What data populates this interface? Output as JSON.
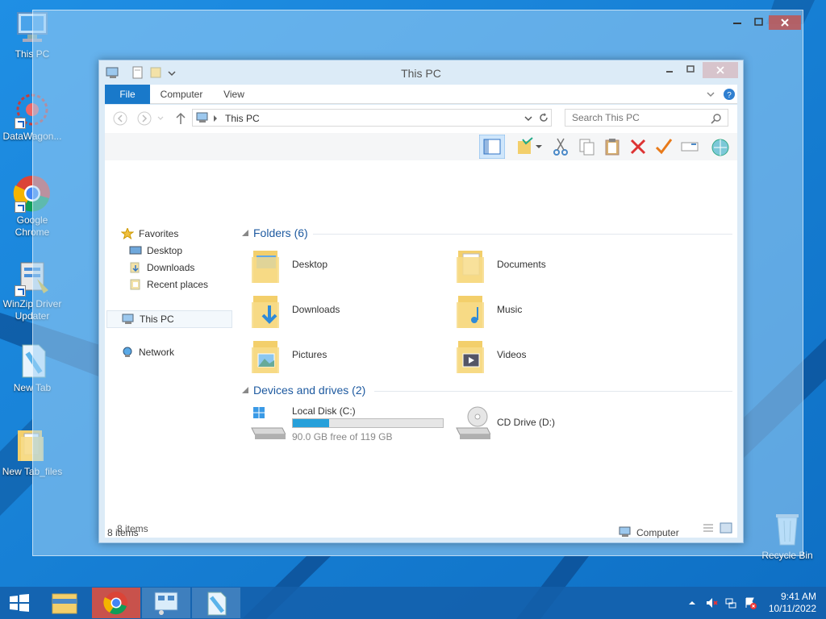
{
  "desktop": {
    "icons": [
      {
        "label": "This PC"
      },
      {
        "label": "DataWagon..."
      },
      {
        "label": "Google Chrome"
      },
      {
        "label": "WinZip Driver Updater"
      },
      {
        "label": "New Tab"
      },
      {
        "label": "New Tab_files"
      },
      {
        "label": "Recycle Bin"
      }
    ]
  },
  "window": {
    "title": "This PC",
    "tabs": [
      "File",
      "Computer",
      "View"
    ],
    "address": "This PC",
    "search_placeholder": "Search This PC"
  },
  "nav": {
    "favorites": "Favorites",
    "favorites_items": [
      "Desktop",
      "Downloads",
      "Recent places"
    ],
    "this_pc": "This PC",
    "network": "Network"
  },
  "main": {
    "folders_header": "Folders (6)",
    "folders": [
      "Desktop",
      "Documents",
      "Downloads",
      "Music",
      "Pictures",
      "Videos"
    ],
    "devices_header": "Devices and drives (2)",
    "drives": [
      {
        "label": "Local Disk (C:)",
        "free": "90.0 GB free of 119 GB",
        "used_fraction": 0.244
      },
      {
        "label": "CD Drive (D:)"
      }
    ]
  },
  "status": {
    "count_inner": "8 items",
    "count_outer": "8 items",
    "computer": "Computer"
  },
  "taskbar": {
    "time": "9:41 AM",
    "date": "10/11/2022"
  },
  "colors": {
    "accent": "#1979ca",
    "folder": "#f3cf6b",
    "group_header": "#1e5aa0"
  }
}
